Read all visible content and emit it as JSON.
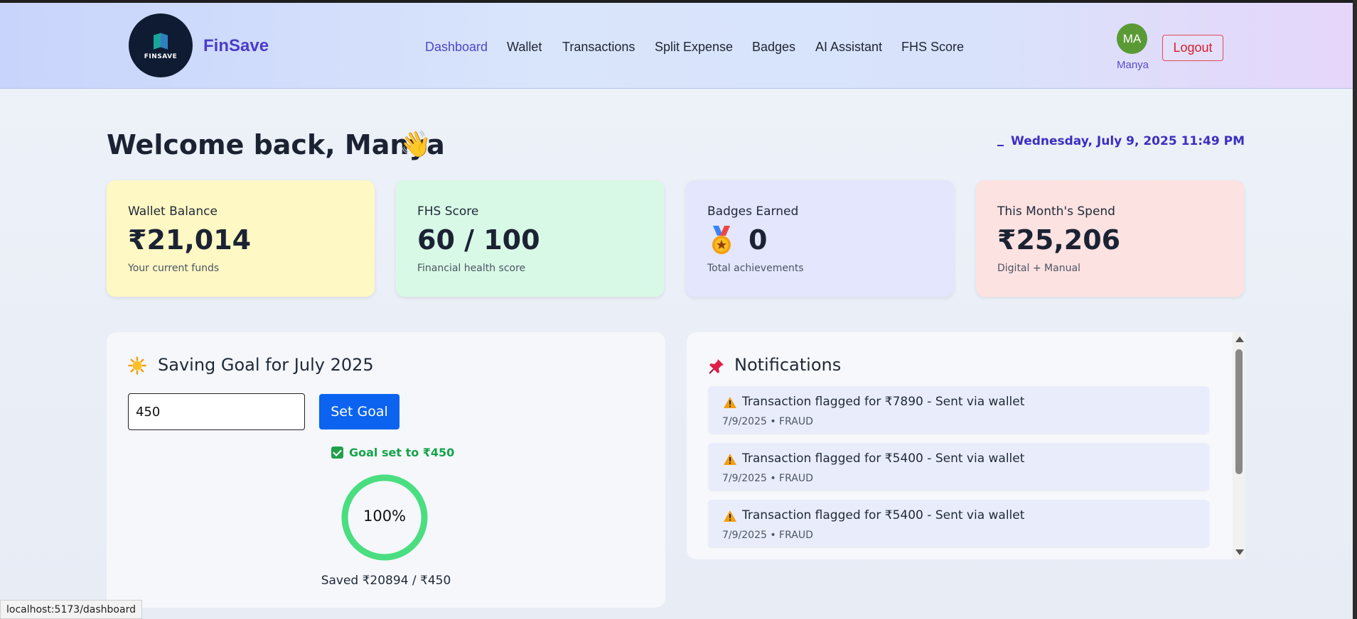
{
  "brand": {
    "logo_text": "FINSAVE",
    "name": "FinSave"
  },
  "nav": {
    "items": [
      {
        "label": "Dashboard",
        "active": true
      },
      {
        "label": "Wallet"
      },
      {
        "label": "Transactions"
      },
      {
        "label": "Split Expense"
      },
      {
        "label": "Badges"
      },
      {
        "label": "AI Assistant"
      },
      {
        "label": "FHS Score"
      }
    ]
  },
  "user": {
    "initials": "MA",
    "name": "Manya",
    "logout_label": "Logout"
  },
  "welcome": {
    "title": "Welcome back, Manya",
    "emoji": "👋",
    "datetime": "Wednesday, July 9, 2025 11:49 PM"
  },
  "cards": [
    {
      "title": "Wallet Balance",
      "value": "₹21,014",
      "sub": "Your current funds",
      "bg": "#fef8c4"
    },
    {
      "title": "FHS Score",
      "value": "60 / 100",
      "sub": "Financial health score",
      "bg": "#d8f9e6"
    },
    {
      "title": "Badges Earned",
      "value": "0",
      "sub": "Total achievements",
      "bg": "#e3e6fc",
      "icon": "medal-icon"
    },
    {
      "title": "This Month's Spend",
      "value": "₹25,206",
      "sub": "Digital + Manual",
      "bg": "#fde2e2"
    }
  ],
  "goal": {
    "title": "Saving Goal for July 2025",
    "input_value": "450",
    "button_label": "Set Goal",
    "status": "Goal set to ₹450",
    "progress_label": "100%",
    "progress": 1.0,
    "saved": "Saved ₹20894 / ₹450",
    "ring_color": "#4ade80"
  },
  "notifications": {
    "title": "Notifications",
    "items": [
      {
        "text": "Transaction flagged for ₹7890 - Sent via wallet",
        "meta": "7/9/2025 • FRAUD"
      },
      {
        "text": "Transaction flagged for ₹5400 - Sent via wallet",
        "meta": "7/9/2025 • FRAUD"
      },
      {
        "text": "Transaction flagged for ₹5400 - Sent via wallet",
        "meta": "7/9/2025 • FRAUD"
      }
    ]
  },
  "statusbar": {
    "url": "localhost:5173/dashboard"
  }
}
